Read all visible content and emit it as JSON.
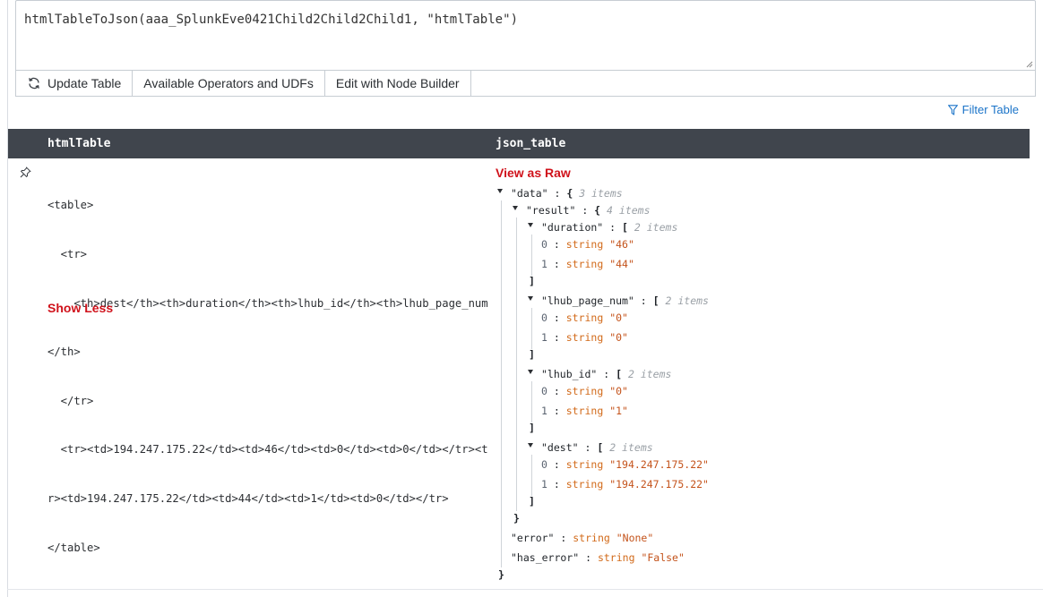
{
  "query": {
    "text": "htmlTableToJson(aaa_SplunkEve0421Child2Child2Child1, \"htmlTable\")"
  },
  "toolbar": {
    "update_label": "Update Table",
    "operators_label": "Available Operators and UDFs",
    "node_builder_label": "Edit with Node Builder"
  },
  "filter_label": "Filter Table",
  "columns": [
    "htmlTable",
    "json_table"
  ],
  "html_cell": {
    "lines": [
      "<table>",
      "  <tr>",
      "    <th>dest</th><th>duration</th><th>lhub_id</th><th>lhub_page_num",
      "</th>",
      "  </tr>",
      "  <tr><td>194.247.175.22</td><td>46</td><td>0</td><td>0</td></tr><t",
      "r><td>194.247.175.22</td><td>44</td><td>1</td><td>0</td></tr>",
      "</table>"
    ],
    "toggle_label": "Show Less"
  },
  "json_cell": {
    "view_raw_label": "View as Raw",
    "data_key": "\"data\"",
    "data_count": "3 items",
    "result_key": "\"result\"",
    "result_count": "4 items",
    "duration_key": "\"duration\"",
    "duration_count": "2 items",
    "duration_0": "\"46\"",
    "duration_1": "\"44\"",
    "page_key": "\"lhub_page_num\"",
    "page_count": "2 items",
    "page_0": "\"0\"",
    "page_1": "\"0\"",
    "id_key": "\"lhub_id\"",
    "id_count": "2 items",
    "id_0": "\"0\"",
    "id_1": "\"1\"",
    "dest_key": "\"dest\"",
    "dest_count": "2 items",
    "dest_0": "\"194.247.175.22\"",
    "dest_1": "\"194.247.175.22\"",
    "error_key": "\"error\"",
    "error_val": "\"None\"",
    "has_error_key": "\"has_error\"",
    "has_error_val": "\"False\"",
    "type_label": "string",
    "idx0": "0",
    "idx1": "1",
    "open_obj": "{",
    "open_arr": "[",
    "close_obj": "}",
    "close_arr": "]",
    "sep": " : "
  },
  "colors": {
    "header_bg": "#40454d",
    "link_red": "#d0121b",
    "link_blue": "#1a73c8",
    "string_value": "#c4531b"
  }
}
